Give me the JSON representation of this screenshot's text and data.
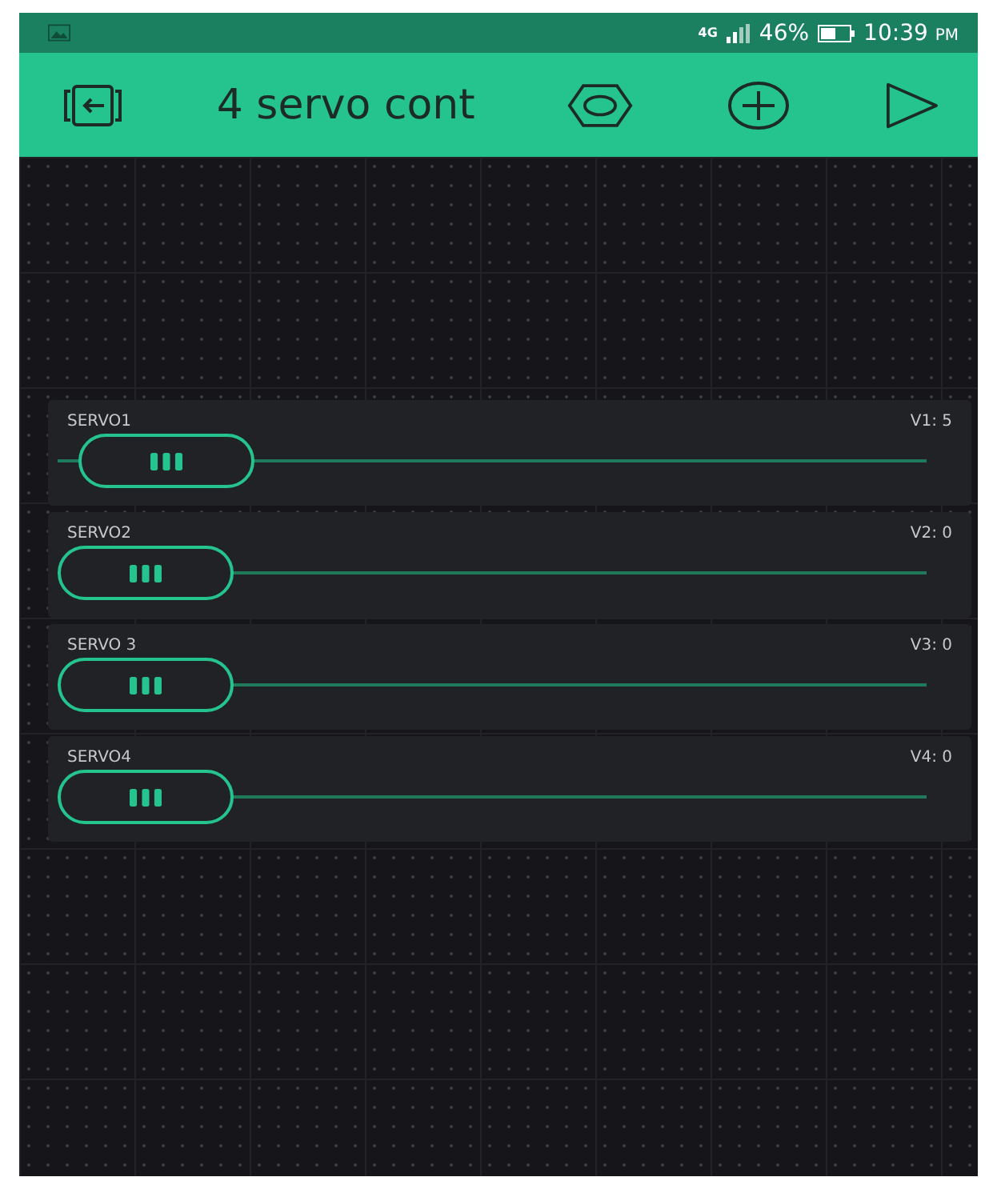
{
  "status_bar": {
    "network": "4G",
    "battery": "46%",
    "time": "10:39",
    "ampm": "PM"
  },
  "toolbar": {
    "title": "4 servo cont"
  },
  "sliders": [
    {
      "label": "SERVO1",
      "pin": "V1: 5",
      "level": 0.03
    },
    {
      "label": "SERVO2",
      "pin": "V2: 0",
      "level": 0
    },
    {
      "label": "SERVO 3",
      "pin": "V3: 0",
      "level": 0
    },
    {
      "label": "SERVO4",
      "pin": "V4: 0",
      "level": 0
    }
  ]
}
